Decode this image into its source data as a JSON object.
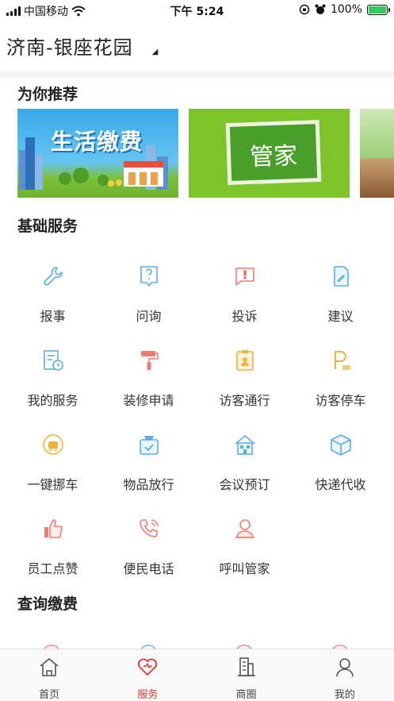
{
  "status_bar": {
    "carrier": "中国移动",
    "time": "下午 5:24",
    "battery_percent": "100%",
    "battery_level": 1.0,
    "battery_color": "#34c759"
  },
  "header": {
    "location": "济南-银座花园"
  },
  "recommend": {
    "title": "为你推荐",
    "banners": [
      {
        "text": "生活缴费"
      },
      {
        "text": "管家"
      },
      {
        "text": ""
      }
    ]
  },
  "basic_services": {
    "title": "基础服务",
    "items": [
      {
        "label": "报事",
        "icon": "wrench-icon"
      },
      {
        "label": "问询",
        "icon": "question-icon"
      },
      {
        "label": "投诉",
        "icon": "complaint-icon"
      },
      {
        "label": "建议",
        "icon": "edit-doc-icon"
      },
      {
        "label": "我的服务",
        "icon": "service-record-icon"
      },
      {
        "label": "装修申请",
        "icon": "paint-roller-icon"
      },
      {
        "label": "访客通行",
        "icon": "visitor-pass-icon"
      },
      {
        "label": "访客停车",
        "icon": "parking-icon"
      },
      {
        "label": "一键挪车",
        "icon": "move-car-icon"
      },
      {
        "label": "物品放行",
        "icon": "package-release-icon"
      },
      {
        "label": "会议预订",
        "icon": "meeting-room-icon"
      },
      {
        "label": "快递代收",
        "icon": "parcel-box-icon"
      },
      {
        "label": "员工点赞",
        "icon": "thumbs-up-icon"
      },
      {
        "label": "便民电话",
        "icon": "phone-icon"
      },
      {
        "label": "呼叫管家",
        "icon": "butler-icon"
      }
    ]
  },
  "query_payment": {
    "title": "查询缴费"
  },
  "tabbar": {
    "tabs": [
      {
        "label": "首页",
        "icon": "home-icon"
      },
      {
        "label": "服务",
        "icon": "heart-icon",
        "active": true
      },
      {
        "label": "商圈",
        "icon": "building-icon"
      },
      {
        "label": "我的",
        "icon": "user-icon"
      }
    ],
    "active_color": "#e8313b"
  },
  "colors": {
    "blue_icon": "#5aaee8",
    "red_icon": "#f07b73",
    "orange_icon": "#f3b23c"
  }
}
